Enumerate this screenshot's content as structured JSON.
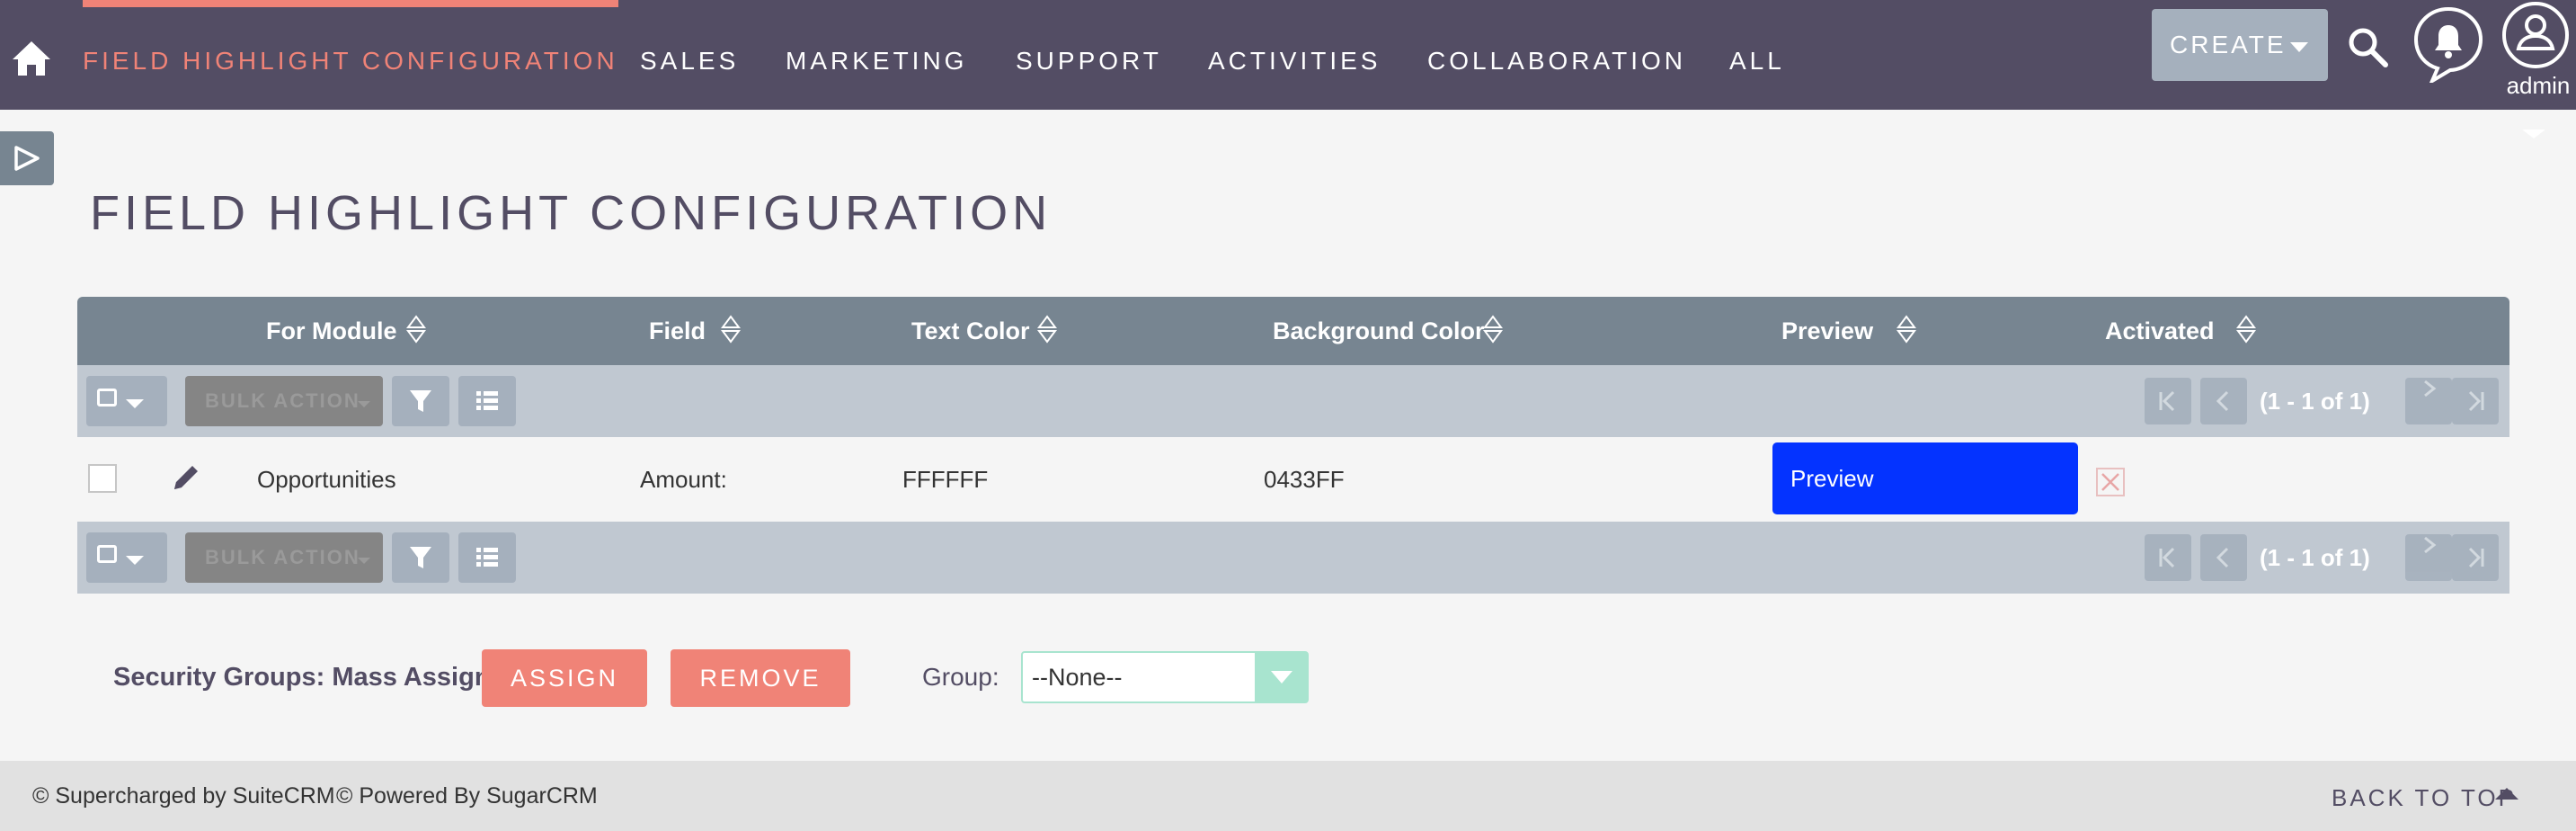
{
  "nav": {
    "items": [
      {
        "label": "FIELD HIGHLIGHT CONFIGURATION",
        "active": true
      },
      {
        "label": "SALES"
      },
      {
        "label": "MARKETING"
      },
      {
        "label": "SUPPORT"
      },
      {
        "label": "ACTIVITIES"
      },
      {
        "label": "COLLABORATION"
      },
      {
        "label": "ALL"
      }
    ],
    "create_label": "CREATE",
    "user_label": "admin"
  },
  "page": {
    "title": "FIELD HIGHLIGHT CONFIGURATION"
  },
  "table": {
    "columns": [
      "For Module",
      "Field",
      "Text Color",
      "Background Color",
      "Preview",
      "Activated"
    ],
    "bulk_action_label": "BULK ACTION",
    "pagination_text": "(1 - 1 of 1)",
    "rows": [
      {
        "for_module": "Opportunities",
        "field": "Amount:",
        "text_color": "FFFFFF",
        "background_color": "0433FF",
        "preview_label": "Preview",
        "activated": false
      }
    ]
  },
  "mass_assign": {
    "label": "Security Groups: Mass Assign",
    "assign_label": "ASSIGN",
    "remove_label": "REMOVE",
    "group_label": "Group:",
    "group_value": "--None--"
  },
  "footer": {
    "suitecrm": "© Supercharged by SuiteCRM",
    "sugarcrm": "© Powered By SugarCRM",
    "back_to_top": "BACK TO TOP"
  },
  "colors": {
    "nav_bg": "#534d64",
    "accent": "#f08377",
    "header_bg": "#778591",
    "toolbar_bg": "#c0c8d1",
    "preview_bg": "#0433ff"
  }
}
